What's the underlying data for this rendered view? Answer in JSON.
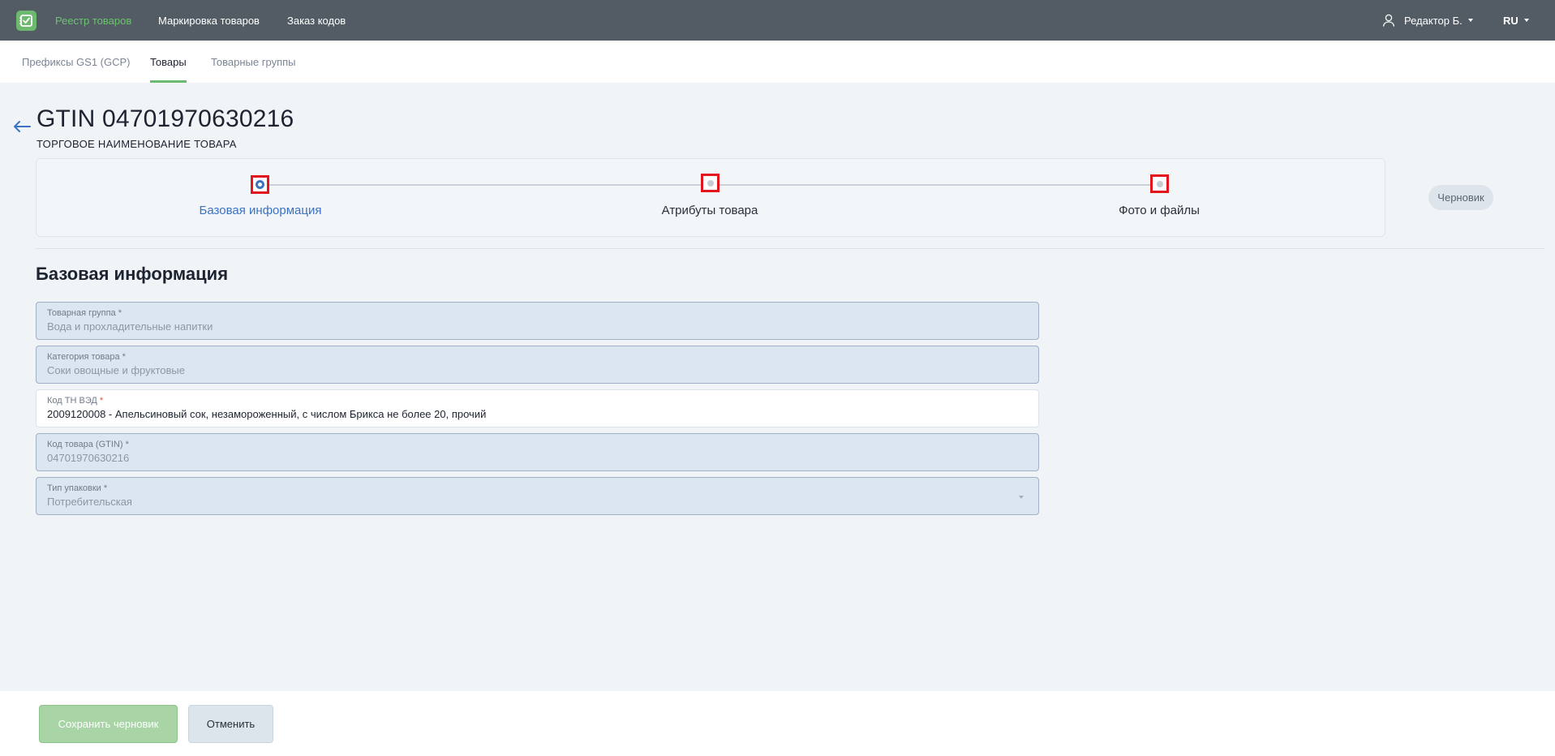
{
  "topbar": {
    "nav": [
      {
        "label": "Реестр товаров",
        "active": true
      },
      {
        "label": "Маркировка товаров",
        "active": false
      },
      {
        "label": "Заказ кодов",
        "active": false
      }
    ],
    "user_name": "Редактор Б.",
    "language": "RU"
  },
  "subnav": {
    "tabs": [
      {
        "label": "Префиксы GS1 (GCP)",
        "active": false
      },
      {
        "label": "Товары",
        "active": true
      },
      {
        "label": "Товарные группы",
        "active": false
      }
    ]
  },
  "header": {
    "title": "GTIN 04701970630216",
    "subtitle": "ТОРГОВОЕ НАИМЕНОВАНИЕ ТОВАРА"
  },
  "stepper": {
    "steps": [
      {
        "label": "Базовая информация",
        "active": true
      },
      {
        "label": "Атрибуты товара",
        "active": false
      },
      {
        "label": "Фото и файлы",
        "active": false
      }
    ],
    "status_badge": "Черновик"
  },
  "section": {
    "title": "Базовая информация"
  },
  "fields": [
    {
      "label": "Товарная группа",
      "required": "*",
      "value": "Вода и прохладительные напитки"
    },
    {
      "label": "Категория товара",
      "required": "*",
      "value": "Соки овощные и фруктовые"
    },
    {
      "label": "Код ТН ВЭД",
      "required": "*",
      "value": "2009120008 - Апельсиновый сок, незамороженный, с числом Брикса не более 20, прочий"
    },
    {
      "label": "Код товара (GTIN)",
      "required": "*",
      "value": "04701970630216"
    },
    {
      "label": "Тип упаковки",
      "required": "*",
      "value": "Потребительская"
    }
  ],
  "footer": {
    "save_label": "Сохранить черновик",
    "cancel_label": "Отменить"
  },
  "colors": {
    "topbar": "#535c65",
    "accent_green": "#6cb96f",
    "accent_blue": "#3a72c4",
    "highlight_red": "#e3141c"
  }
}
